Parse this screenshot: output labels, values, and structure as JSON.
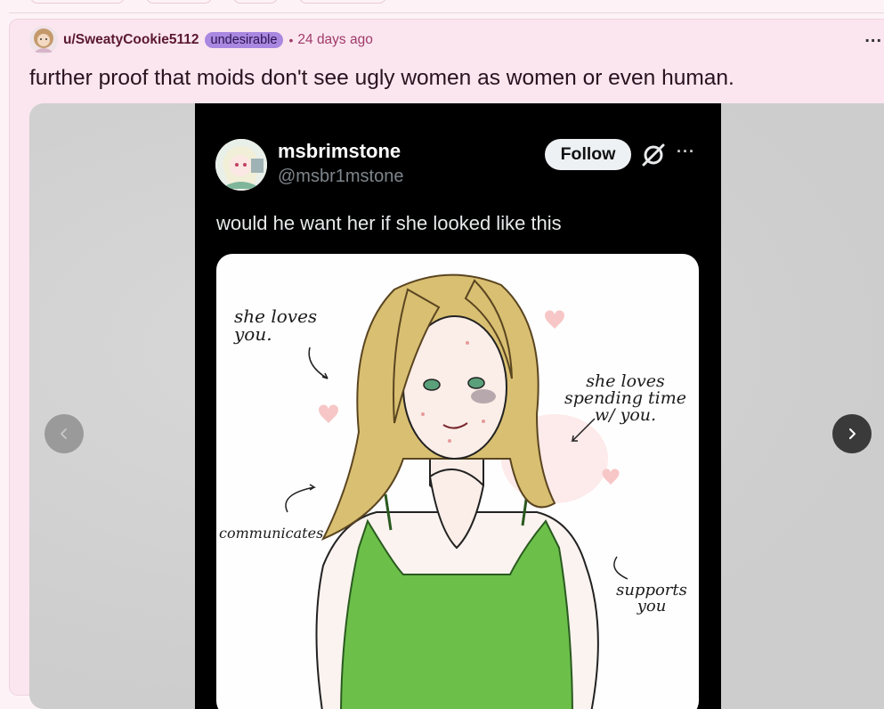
{
  "post": {
    "username": "u/SweatyCookie5112",
    "flair": "undesirable",
    "separator": "•",
    "time": "24 days ago",
    "more_label": "...",
    "title": "further proof that moids don't see ugly women as women or even human."
  },
  "tweet": {
    "name": "msbrimstone",
    "handle": "@msbr1mstone",
    "follow_label": "Follow",
    "more_label": "···",
    "text": "would he want her if she looked like this"
  },
  "drawing": {
    "label_loves": "she loves you.",
    "label_spending": "she loves spending time w/ you.",
    "label_communicates": "communicates",
    "label_supports": "supports you"
  },
  "icons": {
    "prev": "chevron-left-icon",
    "next": "chevron-right-icon",
    "grok": "grok-icon",
    "more": "ellipsis-icon"
  },
  "colors": {
    "page_bg": "#fdf3f7",
    "card_bg": "#fbe6ef",
    "username": "#5b1830",
    "flair_bg": "#a888e0",
    "time": "#a03a6a",
    "follow_bg": "#eef1f4",
    "dress_green": "#6cc04a",
    "hair_blonde": "#d9bf72"
  }
}
